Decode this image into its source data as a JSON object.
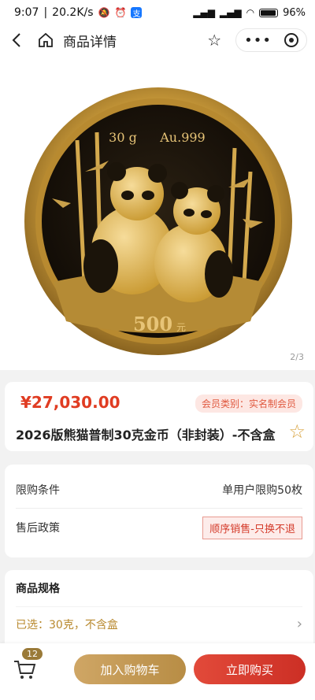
{
  "status": {
    "time": "9:07",
    "speed": "20.2K/s",
    "battery": "96"
  },
  "nav": {
    "title": "商品详情"
  },
  "hero": {
    "coin_weight": "30 g",
    "coin_purity": "Au.999",
    "coin_value": "500",
    "coin_unit": "元",
    "pager": "2/3"
  },
  "product": {
    "price": "¥27,030.00",
    "member_badge": "会员类别：实名制会员",
    "name": "2026版熊猫普制30克金币（非封装）-不含盒"
  },
  "limits": {
    "row1_label": "限购条件",
    "row1_value": "单用户限购50枚",
    "row2_label": "售后政策",
    "row2_value": "顺序销售-只换不退"
  },
  "spec": {
    "title": "商品规格",
    "selected": "已选：30克，不含盒"
  },
  "bottom": {
    "cart_count": "12",
    "add_to_cart": "加入购物车",
    "buy_now": "立即购买"
  },
  "colors": {
    "price_red": "#e03c22",
    "gold": "#b8892e",
    "buy_red": "#cc2f25"
  }
}
